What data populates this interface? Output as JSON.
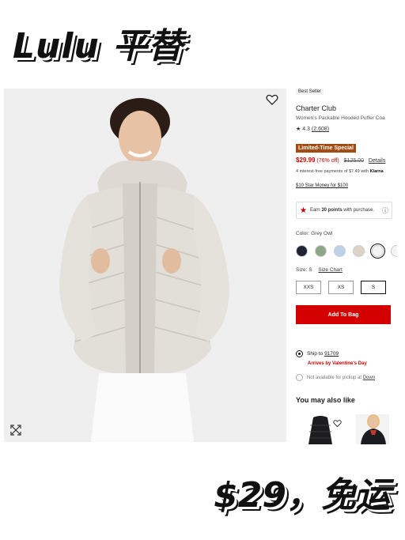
{
  "overlay": {
    "title": "Lulu 平替",
    "price_caption": "$29，免运"
  },
  "product": {
    "best_seller": "Best Seller",
    "brand": "Charter Club",
    "name": "Women's Packable Hooded Puffer Coa",
    "rating_stars": "★ 4.3",
    "rating_count": "(2,608)",
    "limited_badge": "Limited-Time Special",
    "sale_price": "$29.99",
    "discount": "(76% off)",
    "original_price": "$125.00",
    "details_link": "Details",
    "installment_text": "4 interest-free payments of $7.49 with",
    "installment_brand": "Klarna",
    "star_money": "$10 Star Money for $100",
    "rewards_prefix": "Earn",
    "rewards_points": "30 points",
    "rewards_suffix": "with purchase.",
    "color_label": "Color: Grey Owl",
    "swatches": [
      "#1f2533",
      "#8fa58a",
      "#bcd2e6",
      "#ddd3c7",
      "#f4f4f4",
      "#f4f4f4"
    ],
    "size_label": "Size: S",
    "size_chart": "Size Chart",
    "sizes": [
      "XXS",
      "XS",
      "S"
    ],
    "add_to_bag": "Add To Bag",
    "ship_to": "Ship to",
    "zip": "91709",
    "arrival": "Arrives by Valentine's Day",
    "pickup_text": "Not available for pickup at",
    "pickup_store": "Down",
    "also_like": "You may also like"
  },
  "colors": {
    "accent_red": "#d40000",
    "badge_brown": "#a24b12"
  },
  "icons": [
    "heart-icon",
    "expand-icon",
    "star-icon",
    "info-icon"
  ]
}
